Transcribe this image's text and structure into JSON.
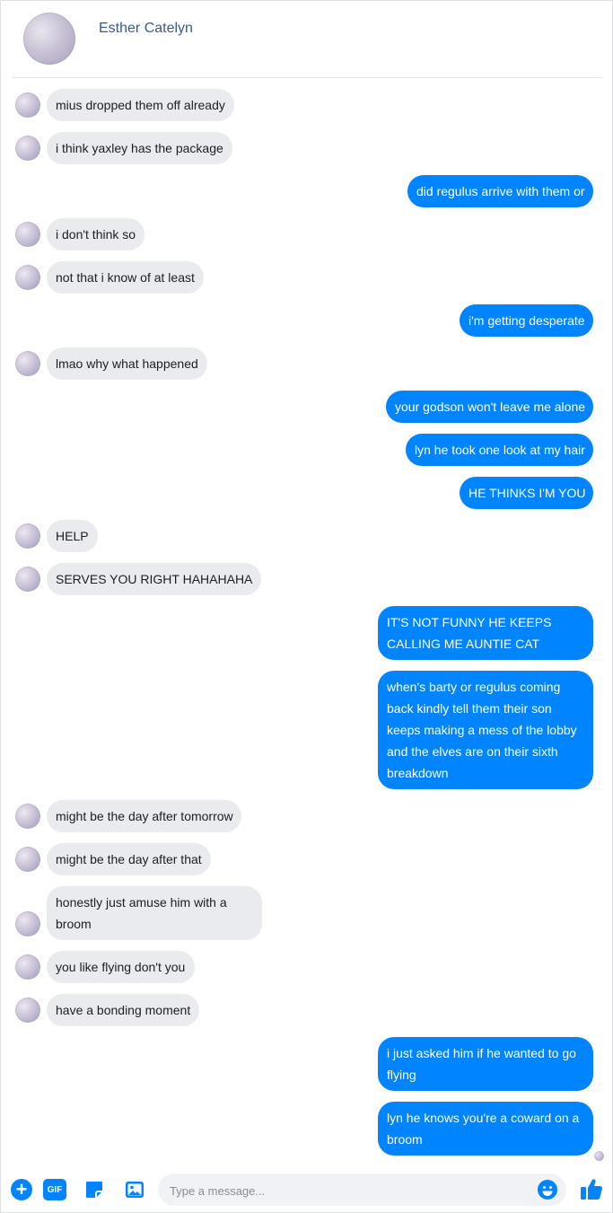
{
  "header": {
    "name": "Esther Catelyn"
  },
  "messages": [
    {
      "dir": "in",
      "text": "mius dropped them off already"
    },
    {
      "dir": "in",
      "text": "i think yaxley has the package"
    },
    {
      "dir": "out",
      "text": "did regulus arrive with them or"
    },
    {
      "dir": "in",
      "text": "i don't think so"
    },
    {
      "dir": "in",
      "text": "not that i know of at least"
    },
    {
      "dir": "out",
      "text": "i'm getting desperate"
    },
    {
      "dir": "in",
      "text": "lmao why what happened"
    },
    {
      "dir": "out",
      "text": "your godson won't leave me alone"
    },
    {
      "dir": "out",
      "text": "lyn he took one look at my hair"
    },
    {
      "dir": "out",
      "text": "HE THINKS I'M YOU"
    },
    {
      "dir": "in",
      "text": "HELP"
    },
    {
      "dir": "in",
      "text": "SERVES YOU RIGHT HAHAHAHA"
    },
    {
      "dir": "out",
      "text": "IT'S NOT FUNNY HE KEEPS CALLING ME AUNTIE CAT"
    },
    {
      "dir": "out",
      "text": "when's barty or regulus coming back kindly tell them their son keeps making a mess of the lobby and the elves are on their sixth breakdown"
    },
    {
      "dir": "in",
      "text": "might be the day after tomorrow"
    },
    {
      "dir": "in",
      "text": "might be the day after that"
    },
    {
      "dir": "in",
      "text": "honestly just amuse him with a broom"
    },
    {
      "dir": "in",
      "text": "you like flying don't you"
    },
    {
      "dir": "in",
      "text": "have a bonding moment"
    },
    {
      "dir": "out",
      "text": "i just asked him if he wanted to go flying"
    },
    {
      "dir": "out",
      "text": "lyn he knows you're a coward on a broom"
    }
  ],
  "composer": {
    "placeholder": "Type a message...",
    "gif_label": "GIF",
    "plus_label": "+"
  },
  "colors": {
    "outgoing_bubble": "#0084ff",
    "incoming_bubble": "#e9ebee",
    "accent": "#0084ff",
    "header_name": "#385898"
  },
  "icons": [
    "plus-icon",
    "gif-icon",
    "sticker-icon",
    "image-icon",
    "emoji-icon",
    "like-icon"
  ]
}
